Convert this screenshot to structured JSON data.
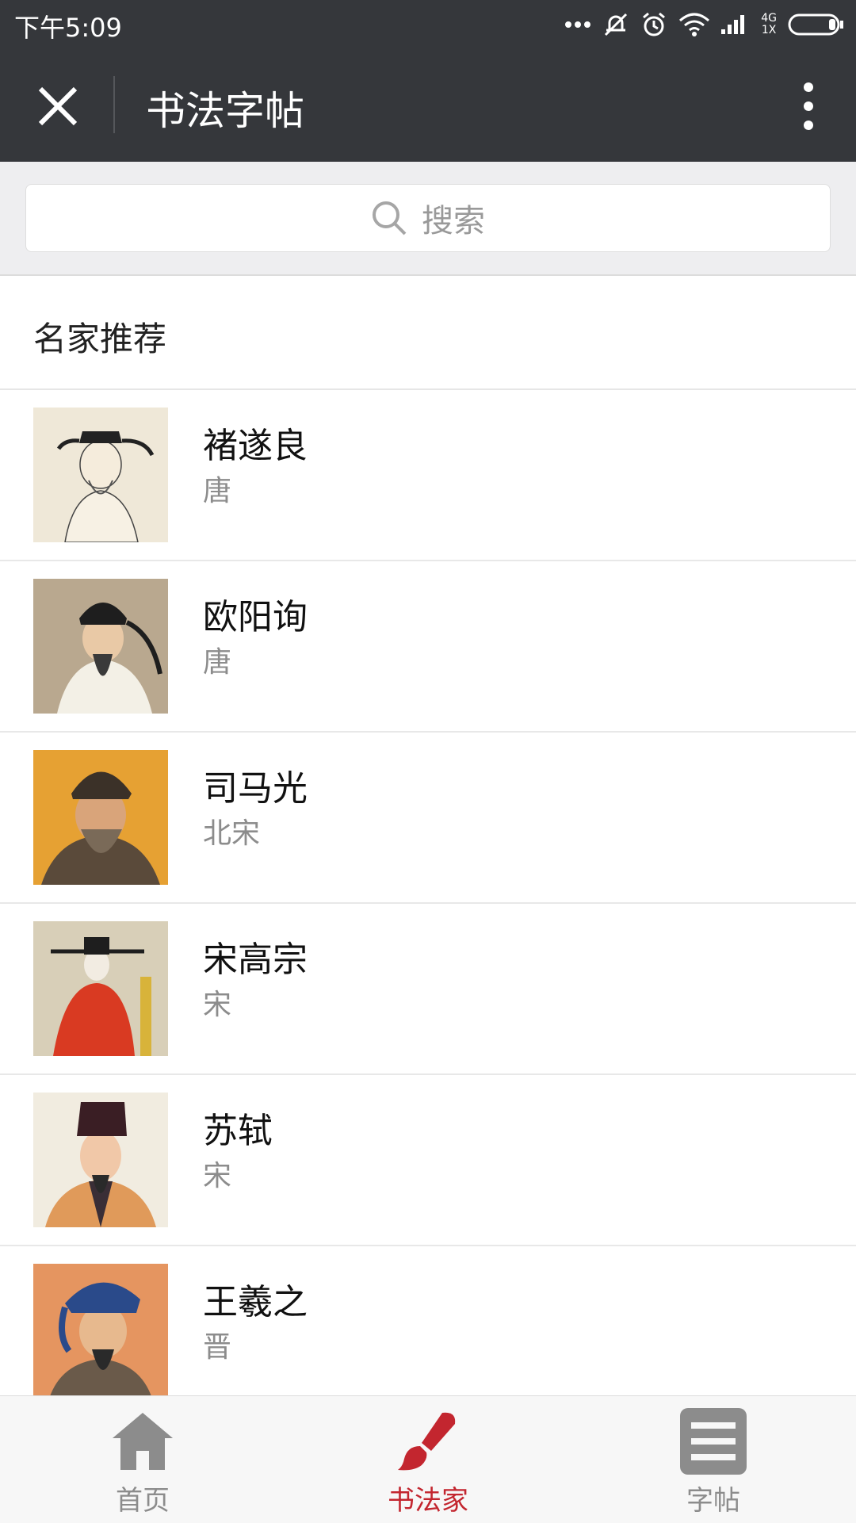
{
  "status_bar": {
    "time": "下午5:09",
    "network": "4G",
    "sim": "1X",
    "icons": [
      "more-dots-icon",
      "mute-bell-icon",
      "alarm-icon",
      "wifi-icon",
      "signal-icon",
      "battery-icon"
    ]
  },
  "header": {
    "title": "书法字帖",
    "close_icon": "close-icon",
    "menu_icon": "more-vertical-icon",
    "bg_color": "#35373b"
  },
  "search": {
    "placeholder": "搜索"
  },
  "section": {
    "title": "名家推荐"
  },
  "calligraphers": [
    {
      "name": "褚遂良",
      "dynasty": "唐"
    },
    {
      "name": "欧阳询",
      "dynasty": "唐"
    },
    {
      "name": "司马光",
      "dynasty": "北宋"
    },
    {
      "name": "宋高宗",
      "dynasty": "宋"
    },
    {
      "name": "苏轼",
      "dynasty": "宋"
    },
    {
      "name": "王羲之",
      "dynasty": "晋"
    }
  ],
  "bottom_nav": {
    "items": [
      {
        "label": "首页",
        "icon": "home-icon",
        "active": false
      },
      {
        "label": "书法家",
        "icon": "brush-icon",
        "active": true
      },
      {
        "label": "字帖",
        "icon": "list-icon",
        "active": false
      }
    ],
    "active_color": "#c3262f",
    "inactive_color": "#8c8c8c"
  }
}
